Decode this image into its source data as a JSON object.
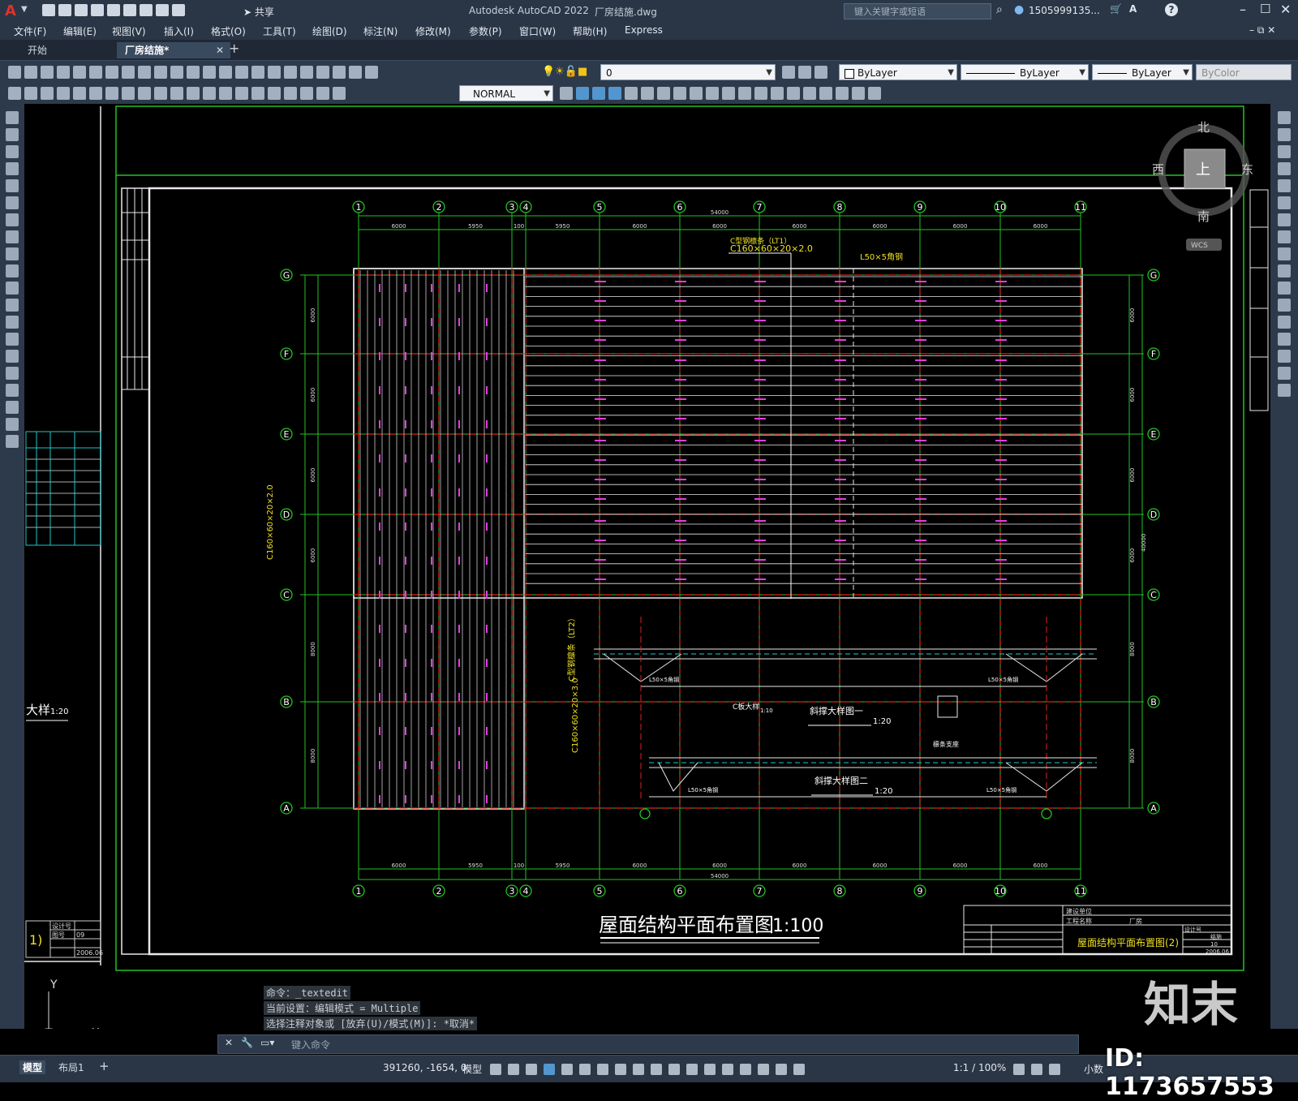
{
  "app": {
    "name": "Autodesk AutoCAD 2022",
    "file": "厂房结施.dwg",
    "search_placeholder": "键入关键字或短语",
    "user": "1505999135...",
    "share": "共享",
    "logo": "A"
  },
  "menu": [
    "文件(F)",
    "编辑(E)",
    "视图(V)",
    "插入(I)",
    "格式(O)",
    "工具(T)",
    "绘图(D)",
    "标注(N)",
    "修改(M)",
    "参数(P)",
    "窗口(W)",
    "帮助(H)",
    "Express"
  ],
  "tabs": [
    {
      "label": "开始",
      "active": false
    },
    {
      "label": "厂房结施*",
      "active": true
    }
  ],
  "layer_combo": "0",
  "props": {
    "color": "ByLayer",
    "linetype": "ByLayer",
    "lineweight": "ByLayer",
    "plotstyle": "ByColor"
  },
  "textstyle": "NORMAL",
  "viewcube": {
    "north": "北",
    "south": "南",
    "east": "东",
    "west": "西",
    "top": "上",
    "wcs": "WCS"
  },
  "drawing": {
    "title": "屋面结构平面布置图",
    "scale": "1:100",
    "axes_top": [
      "1",
      "2",
      "3",
      "4",
      "5",
      "6",
      "7",
      "8",
      "9",
      "10",
      "11"
    ],
    "axes_side": [
      "G",
      "F",
      "E",
      "D",
      "C",
      "B",
      "A"
    ],
    "dims_top": [
      "6000",
      "5950",
      "100",
      "5950",
      "6000",
      "6000",
      "6000",
      "6000",
      "6000",
      "6000"
    ],
    "total_width": "54000",
    "side_dims": [
      "6000",
      "6000",
      "6000",
      "6000",
      "8000",
      "8000"
    ],
    "total_height": "40000",
    "label_lt1": "C型钢檩条（LT1）",
    "label_lt1_size": "C160×60×20×2.0",
    "label_lt2": "C型钢檩条（LT2）",
    "label_lt2_size": "C160×60×20×3.0",
    "brace_label": "L50×5角钢",
    "detail1": "斜撑大样图一",
    "detail2": "斜撑大样图二",
    "detail_scale": "1:20",
    "c_detail": "C板大样",
    "c_detail_scale": "1:10",
    "seat_detail": "檩条支座",
    "left_detail": "大样",
    "left_detail_scale": "1:20",
    "titleblock": {
      "unit_label": "建设单位",
      "project_label": "工程名称",
      "project": "厂房",
      "sheet_title": "屋面结构平面布置图(2)",
      "sheet_no": "10",
      "date": "2006.06",
      "design_no": "设计号",
      "drawing_no": "图号",
      "drawing_type": "结施",
      "left_no": "09",
      "left_date": "2006.06"
    }
  },
  "command_history": [
    "命令：_textedit",
    "当前设置：编辑模式 = Multiple",
    "选择注释对象或 [放弃(U)/模式(M)]: *取消*"
  ],
  "command_placeholder": "键入命令",
  "layout_tabs": [
    "模型",
    "布局1"
  ],
  "coords": "391260, -1654, 0",
  "status": {
    "mode": "模型",
    "scale": "1:1 / 100%",
    "units": "小数"
  },
  "overlay": {
    "brand": "知末",
    "id": "ID: 1173657553"
  }
}
